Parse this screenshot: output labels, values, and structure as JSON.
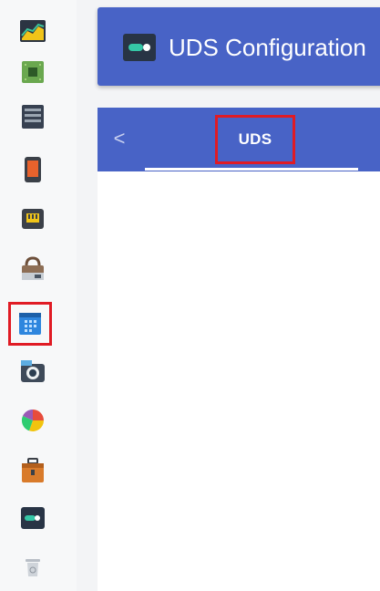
{
  "dock": {
    "items": [
      {
        "icon": "system-monitor-icon"
      },
      {
        "icon": "cpu-chip-icon"
      },
      {
        "icon": "storage-drive-icon"
      },
      {
        "icon": "mobile-device-icon"
      },
      {
        "icon": "network-port-icon"
      },
      {
        "icon": "package-installer-icon"
      },
      {
        "icon": "calendar-grid-icon",
        "selected": true
      },
      {
        "icon": "camera-icon"
      },
      {
        "icon": "pie-chart-icon"
      },
      {
        "icon": "briefcase-icon"
      },
      {
        "icon": "uds-toggle-icon"
      },
      {
        "icon": "trash-icon"
      }
    ]
  },
  "header": {
    "icon": "uds-toggle-icon",
    "title": "UDS Configuration"
  },
  "tabs": {
    "back_glyph": "<",
    "items": [
      {
        "label": "UDS",
        "active": true
      }
    ]
  },
  "colors": {
    "accent": "#4863c6",
    "highlight": "#e01b24",
    "toggle": "#35c7a6"
  }
}
